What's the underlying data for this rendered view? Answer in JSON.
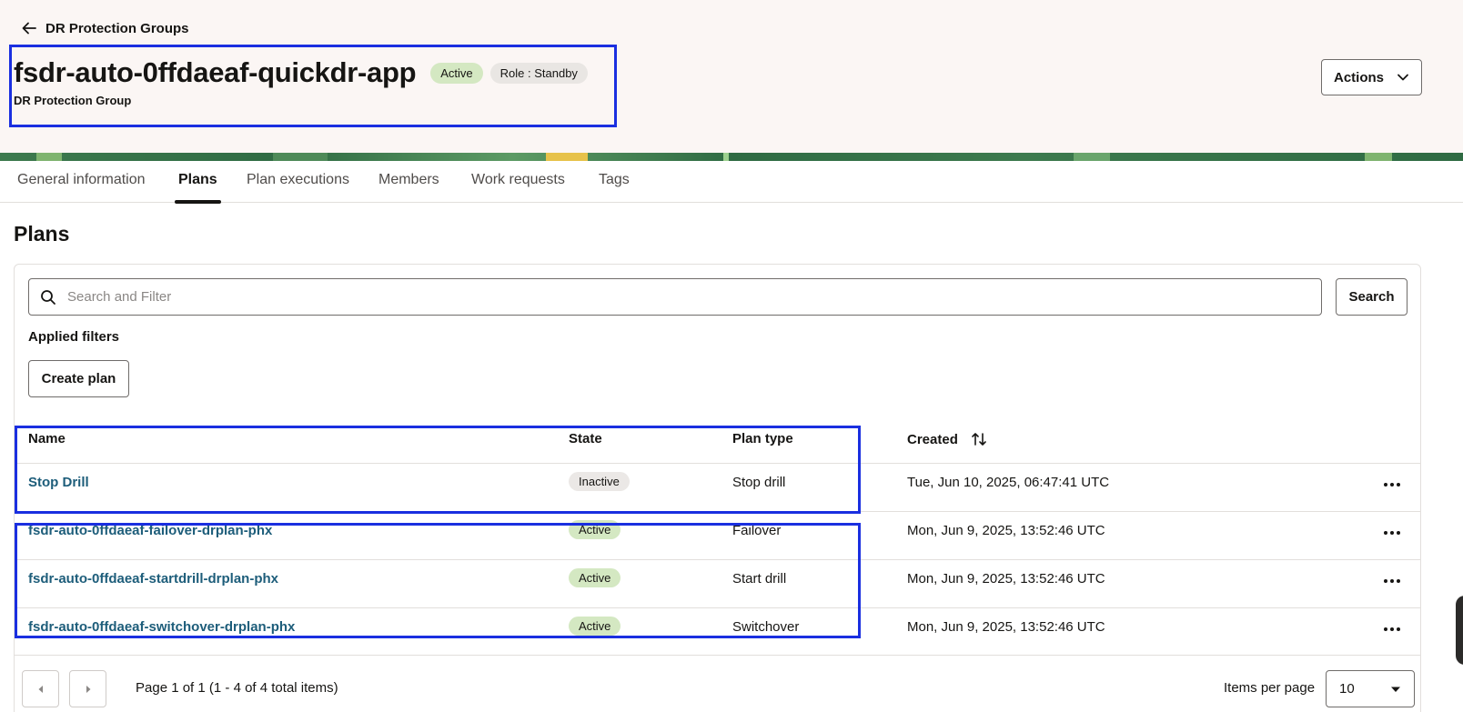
{
  "header": {
    "back_label": "DR Protection Groups",
    "title": "fsdr-auto-0ffdaeaf-quickdr-app",
    "status_badge": "Active",
    "role_badge": "Role : Standby",
    "subtitle": "DR Protection Group",
    "actions_label": "Actions"
  },
  "tabs": [
    {
      "label": "General information"
    },
    {
      "label": "Plans"
    },
    {
      "label": "Plan executions"
    },
    {
      "label": "Members"
    },
    {
      "label": "Work requests"
    },
    {
      "label": "Tags"
    }
  ],
  "active_tab": "Plans",
  "section_title": "Plans",
  "search": {
    "placeholder": "Search and Filter",
    "button_label": "Search"
  },
  "applied_filters_label": "Applied filters",
  "create_plan_label": "Create plan",
  "table": {
    "columns": {
      "name": "Name",
      "state": "State",
      "plan_type": "Plan type",
      "created": "Created"
    },
    "rows": [
      {
        "name": "Stop Drill",
        "state": "Inactive",
        "plan_type": "Stop drill",
        "created": "Tue, Jun 10, 2025, 06:47:41 UTC"
      },
      {
        "name": "fsdr-auto-0ffdaeaf-failover-drplan-phx",
        "state": "Active",
        "plan_type": "Failover",
        "created": "Mon, Jun 9, 2025, 13:52:46 UTC"
      },
      {
        "name": "fsdr-auto-0ffdaeaf-startdrill-drplan-phx",
        "state": "Active",
        "plan_type": "Start drill",
        "created": "Mon, Jun 9, 2025, 13:52:46 UTC"
      },
      {
        "name": "fsdr-auto-0ffdaeaf-switchover-drplan-phx",
        "state": "Active",
        "plan_type": "Switchover",
        "created": "Mon, Jun 9, 2025, 13:52:46 UTC"
      }
    ]
  },
  "pagination": {
    "summary": "Page 1 of 1 (1 - 4 of 4 total items)",
    "items_per_page_label": "Items per page",
    "items_per_page_value": "10"
  },
  "colors": {
    "highlight_box": "#1a2fe0",
    "link": "#1d5d7a",
    "active_badge": "#d4e8c2",
    "header_bg": "#fbf6f4"
  }
}
